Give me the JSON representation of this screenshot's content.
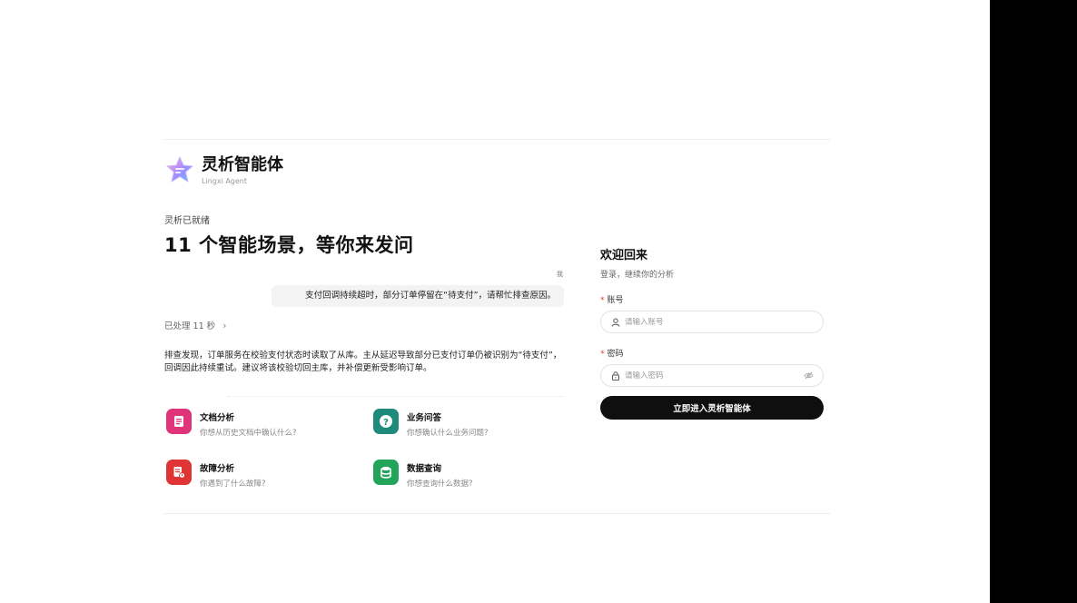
{
  "brand": {
    "title": "灵析智能体",
    "subtitle": "Lingxi Agent"
  },
  "status": "灵析已就绪",
  "headline": "11 个智能场景，等你来发问",
  "chat": {
    "user_label": "我",
    "user_message": "支付回调持续超时，部分订单停留在“待支付”，请帮忙排查原因。",
    "processed": "已处理 11 秒",
    "answer": "排查发现，订单服务在校验支付状态时读取了从库。主从延迟导致部分已支付订单仍被识别为“待支付”，回调因此持续重试。建议将该校验切回主库，并补偿更新受影响订单。"
  },
  "scenarios": [
    {
      "title": "文档分析",
      "desc": "你想从历史文档中确认什么?",
      "icon": "document-icon",
      "color": "#e0347a"
    },
    {
      "title": "业务问答",
      "desc": "你想确认什么业务问题?",
      "icon": "question-icon",
      "color": "#1d8a7a"
    },
    {
      "title": "故障分析",
      "desc": "你遇到了什么故障?",
      "icon": "fault-report-icon",
      "color": "#e03535"
    },
    {
      "title": "数据查询",
      "desc": "你想查询什么数据?",
      "icon": "database-icon",
      "color": "#22a55a"
    }
  ],
  "login": {
    "title": "欢迎回来",
    "subtitle": "登录，继续你的分析",
    "account_label": "账号",
    "account_placeholder": "请输入账号",
    "password_label": "密码",
    "password_placeholder": "请输入密码",
    "required_mark": "*",
    "submit_label": "立即进入灵析智能体"
  }
}
